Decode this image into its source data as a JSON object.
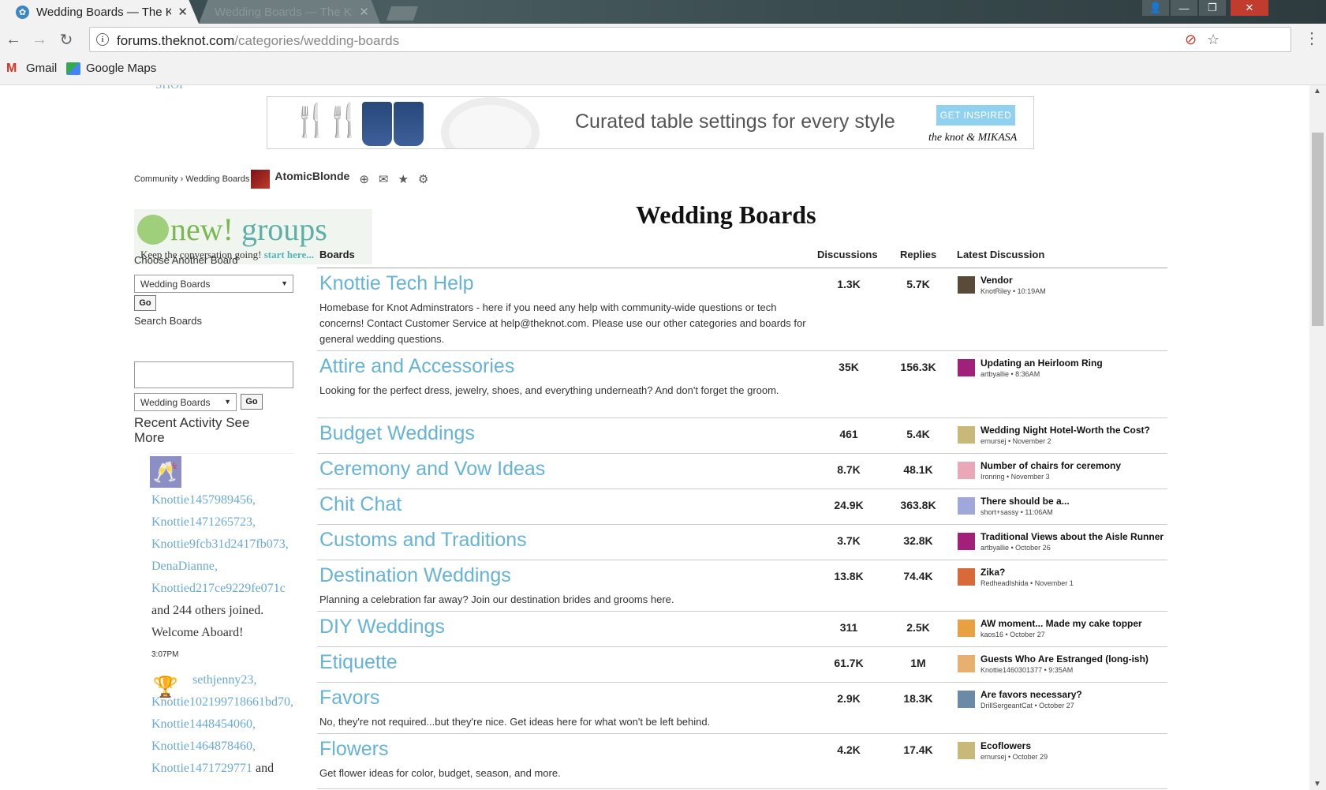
{
  "browser": {
    "tabs": [
      {
        "title": "Wedding Boards — The Knot",
        "active": true
      },
      {
        "title": "Wedding Boards — The Knot",
        "active": false
      }
    ],
    "url_domain": "forums.theknot.com",
    "url_path": "/categories/wedding-boards",
    "bookmarks": [
      "Gmail",
      "Google Maps"
    ]
  },
  "banner": {
    "text": "Curated table settings for every style",
    "cta": "GET INSPIRED",
    "brand": "the knot & MIKASA"
  },
  "breadcrumb": {
    "items": [
      "Community",
      "Wedding Boards"
    ],
    "user": "AtomicBlonde"
  },
  "groups_promo": {
    "word_new": "new!",
    "word_groups": "groups",
    "tagline": "Keep the conversation going!",
    "link": "start here..."
  },
  "sidebar": {
    "choose_label": "Choose Another Board",
    "choose_value": "Wedding Boards",
    "go_label": "Go",
    "search_label": "Search Boards",
    "search_scope": "Wedding Boards",
    "recent_title": "Recent Activity See More",
    "activity": [
      {
        "users": [
          "Knottie1457989456,",
          "Knottie1471265723,",
          "Knottie9fcb31d2417fb073,",
          "DenaDianne,",
          "Knottied217ce9229fe071c"
        ],
        "tail1": "and 244 others joined.",
        "tail2": "Welcome Aboard!",
        "time": "3:07PM"
      },
      {
        "users": [
          "sethjenny23,",
          "Knottie102199718661bd70,",
          "Knottie1448454060,",
          "Knottie1464878460,",
          "Knottie1471729771"
        ],
        "tail1": "and"
      }
    ]
  },
  "main": {
    "title": "Wedding Boards",
    "headers": {
      "boards": "Boards",
      "discussions": "Discussions",
      "replies": "Replies",
      "latest": "Latest Discussion"
    },
    "boards": [
      {
        "name": "Knottie Tech Help",
        "desc": "Homebase for Knot Adminstrators - here if you need any help with community-wide questions or tech concerns! Contact Customer Service at help@theknot.com. Please use our other categories and boards for general wedding questions.",
        "discussions": "1.3K",
        "replies": "5.7K",
        "latest": "Vendor",
        "meta": "KnotRiley • 10:19AM",
        "avatar": "#5a4a3a"
      },
      {
        "name": "Attire and Accessories",
        "desc": "Looking for the perfect dress, jewelry, shoes, and everything underneath? And don't forget the groom.",
        "discussions": "35K",
        "replies": "156.3K",
        "latest": "Updating an Heirloom Ring",
        "meta": "artbyallie • 8:36AM",
        "avatar": "#a0207a"
      },
      {
        "name": "Budget Weddings",
        "desc": "",
        "discussions": "461",
        "replies": "5.4K",
        "latest": "Wedding Night Hotel-Worth the Cost?",
        "meta": "ernursej • November 2",
        "avatar": "#c8b87a"
      },
      {
        "name": "Ceremony and Vow Ideas",
        "desc": "",
        "discussions": "8.7K",
        "replies": "48.1K",
        "latest": "Number of chairs for ceremony",
        "meta": "Ironring • November 3",
        "avatar": "#e8a8b8"
      },
      {
        "name": "Chit Chat",
        "desc": "",
        "discussions": "24.9K",
        "replies": "363.8K",
        "latest": "There should be a...",
        "meta": "short+sassy • 11:06AM",
        "avatar": "#9fa8d8"
      },
      {
        "name": "Customs and Traditions",
        "desc": "",
        "discussions": "3.7K",
        "replies": "32.8K",
        "latest": "Traditional Views about the Aisle Runner",
        "meta": "artbyallie • October 26",
        "avatar": "#a0207a"
      },
      {
        "name": "Destination Weddings",
        "desc": "Planning a celebration far away? Join our destination brides and grooms here.",
        "discussions": "13.8K",
        "replies": "74.4K",
        "latest": "Zika?",
        "meta": "RedheadIshida • November 1",
        "avatar": "#d86a3a"
      },
      {
        "name": "DIY Weddings",
        "desc": "",
        "discussions": "311",
        "replies": "2.5K",
        "latest": "AW moment... Made my cake topper",
        "meta": "kaos16 • October 27",
        "avatar": "#e8a040"
      },
      {
        "name": "Etiquette",
        "desc": "",
        "discussions": "61.7K",
        "replies": "1M",
        "latest": "Guests Who Are Estranged (long-ish)",
        "meta": "Knottie1460301377 • 9:35AM",
        "avatar": "#e8b070"
      },
      {
        "name": "Favors",
        "desc": "No, they're not required...but they're nice. Get ideas here for what won't be left behind.",
        "discussions": "2.9K",
        "replies": "18.3K",
        "latest": "Are favors necessary?",
        "meta": "DrillSergeantCat • October 27",
        "avatar": "#6a8aa8"
      },
      {
        "name": "Flowers",
        "desc": "Get flower ideas for color, budget, season, and more.",
        "discussions": "4.2K",
        "replies": "17.4K",
        "latest": "Ecoflowers",
        "meta": "ernursej • October 29",
        "avatar": "#c8b87a"
      }
    ]
  }
}
